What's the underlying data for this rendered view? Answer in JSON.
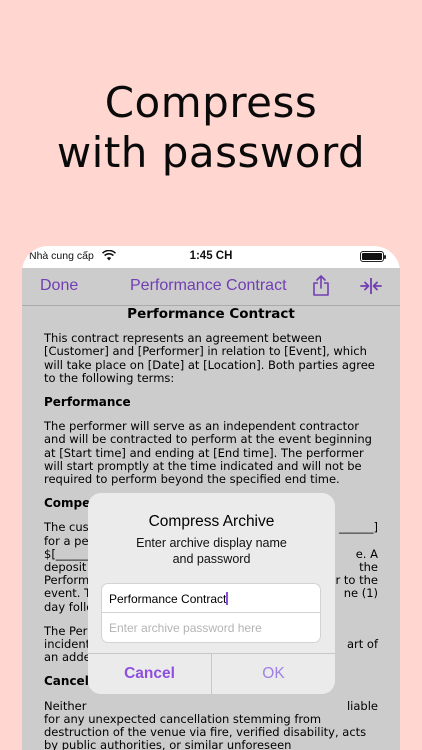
{
  "hero": {
    "line1": "Compress",
    "line2": "with password"
  },
  "status_bar": {
    "carrier": "Nhà cung cấp",
    "time": "1:45 CH"
  },
  "navbar": {
    "done_label": "Done",
    "title": "Performance Contract",
    "share_icon": "share-icon",
    "compress_icon": "compress-icon",
    "accent": "#8E4FE0"
  },
  "document": {
    "heading": "Performance Contract",
    "intro": "This contract represents an agreement between [Customer] and [Performer] in relation to [Event], which will take place on [Date] at [Location]. Both parties agree to the following terms:",
    "section1_title": "Performance",
    "section1_body": "The performer will serve as an independent contractor and will be contracted to perform at the event beginning at [Start time] and ending at [End time]. The performer will start promptly at the time indicated and will not be required to perform beyond the specified end time.",
    "section2_title": "Compen",
    "section2_line1": "The cus",
    "section2_line1_end": "______]",
    "section2_line2": "for a pe",
    "section2_line3": "$[______",
    "section2_line3_end": "e. A",
    "section2_line4": "deposit",
    "section2_line4_end": "the",
    "section2_line5": "Perform",
    "section2_line5_end": "r to the",
    "section2_line6": "event. T",
    "section2_line6_end": "ne (1)",
    "section2_line7": "day follo",
    "section3_line1": "The Per",
    "section3_line2": "incident",
    "section3_line2_end": "art of",
    "section3_line3": "an adde",
    "section4_title": "Cancell",
    "section4_line1": "Neither",
    "section4_line1_end": "liable",
    "section4_body": "for any unexpected cancellation stemming from destruction of the venue via fire, verified disability, acts by public authorities, or similar unforeseen circumstances prior to the date of the Event."
  },
  "dialog": {
    "title": "Compress Archive",
    "message_line1": "Enter archive display name",
    "message_line2": "and password",
    "name_value": "Performance Contract",
    "password_placeholder": "Enter archive password here",
    "cancel_label": "Cancel",
    "ok_label": "OK"
  }
}
